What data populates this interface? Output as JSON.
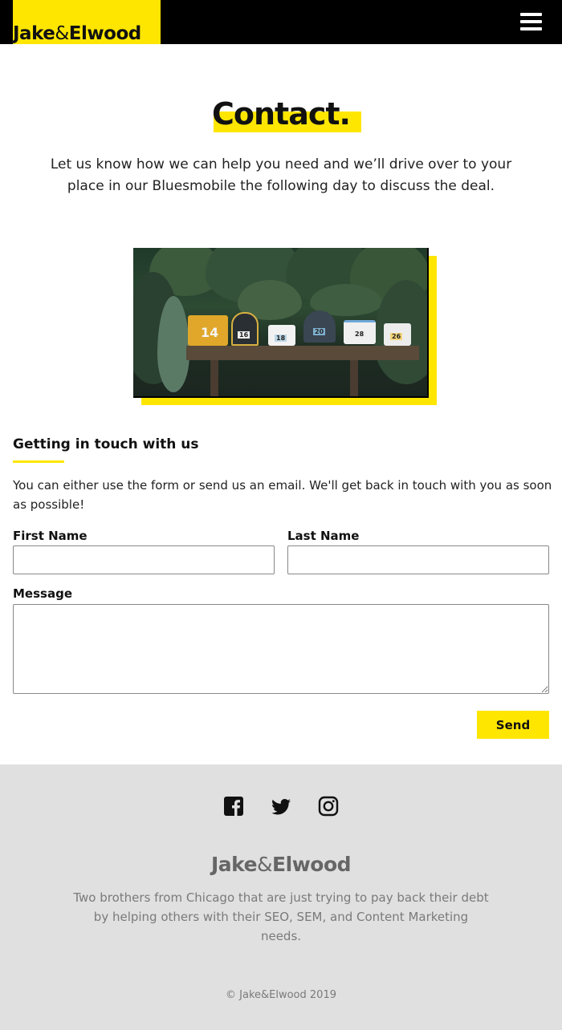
{
  "header": {
    "logo_part1": "Jake",
    "logo_amp": "&",
    "logo_part2": "Elwood",
    "menu_icon": "hamburger-menu-icon"
  },
  "hero": {
    "title": "Contact.",
    "intro": "Let us know how we can help you need and we’ll drive over to your place in our Bluesmobile the following day to discuss the deal."
  },
  "image": {
    "mailbox_numbers": [
      "14",
      "16",
      "18",
      "20",
      "28",
      "26"
    ]
  },
  "contact_section": {
    "title": "Getting in touch with us",
    "description": "You can either use the form or send us an email. We'll get back in touch with you as soon as possible!"
  },
  "form": {
    "first_name_label": "First Name",
    "first_name_value": "",
    "last_name_label": "Last Name",
    "last_name_value": "",
    "message_label": "Message",
    "message_value": "",
    "send_label": "Send"
  },
  "footer": {
    "social_icons": [
      "facebook-icon",
      "twitter-icon",
      "instagram-icon"
    ],
    "logo_part1": "Jake",
    "logo_amp": "&",
    "logo_part2": "Elwood",
    "description": "Two brothers from Chicago that are just trying to pay back their debt by helping others with their SEO, SEM, and Content Marketing needs.",
    "copyright": "© Jake&Elwood 2019"
  },
  "colors": {
    "accent": "#ffe600",
    "header_bg": "#000000",
    "footer_bg": "#e0e0e0"
  }
}
